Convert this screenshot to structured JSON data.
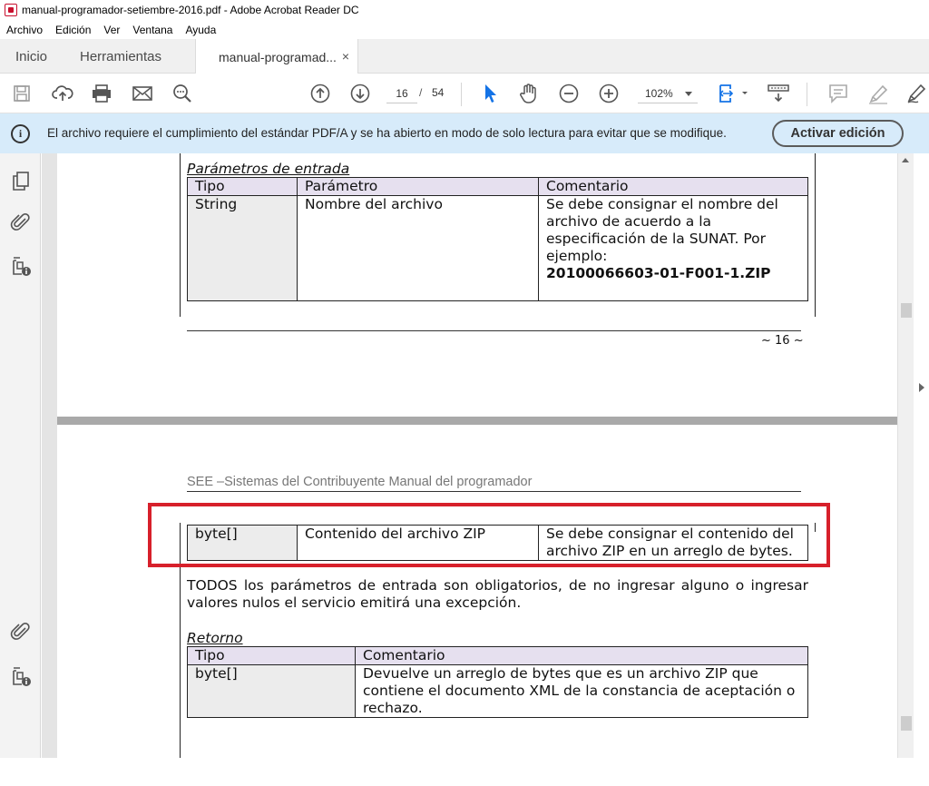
{
  "window": {
    "title": "manual-programador-setiembre-2016.pdf - Adobe Acrobat Reader DC"
  },
  "menu": [
    "Archivo",
    "Edición",
    "Ver",
    "Ventana",
    "Ayuda"
  ],
  "tabs": {
    "home": "Inicio",
    "tools": "Herramientas",
    "document": "manual-programad...",
    "close": "×"
  },
  "toolbar": {
    "current_page": "16",
    "page_separator": "/",
    "total_pages": "54",
    "zoom": "102%",
    "icons": [
      "save-icon",
      "upload-cloud-icon",
      "print-icon",
      "email-icon",
      "search-zoom-icon",
      "previous-page-icon",
      "next-page-icon",
      "select-cursor-icon",
      "hand-icon",
      "zoom-out-icon",
      "zoom-in-icon",
      "page-fit-icon",
      "keyboard-icon",
      "comment-icon",
      "highlight-pen-icon",
      "sign-pen-icon"
    ]
  },
  "banner": {
    "message": "El archivo requiere el cumplimiento del estándar PDF/A y se ha abierto en modo de solo lectura para evitar que se modifique.",
    "button": "Activar edición"
  },
  "page16": {
    "section_title": "Parámetros de entrada",
    "headers": [
      "Tipo",
      "Parámetro",
      "Comentario"
    ],
    "row": {
      "type": "String",
      "param": "Nombre del archivo",
      "comment": "Se debe consignar el nombre del archivo de acuerdo a la especificación de la SUNAT. Por ejemplo:",
      "example": "20100066603-01-F001-1.ZIP"
    },
    "footer": "~ 16 ~"
  },
  "page17": {
    "header": "SEE –Sistemas del Contribuyente Manual del programador",
    "row": {
      "type": "byte[]",
      "param": "Contenido del archivo ZIP",
      "comment": "Se debe consignar el contenido del archivo ZIP en un arreglo de bytes."
    },
    "paragraph": "TODOS los parámetros de entrada son obligatorios, de no ingresar alguno o ingresar valores nulos el servicio emitirá una excepción.",
    "return_title": "Retorno",
    "return_headers": [
      "Tipo",
      "Comentario"
    ],
    "return_row": {
      "type": "byte[]",
      "comment": "Devuelve un arreglo de bytes que es un archivo ZIP que contiene el documento XML de la constancia de aceptación o rechazo."
    }
  },
  "colors": {
    "banner_bg": "#d7ebfa",
    "highlight": "#d7202b",
    "table_header": "#e6e0ef"
  }
}
